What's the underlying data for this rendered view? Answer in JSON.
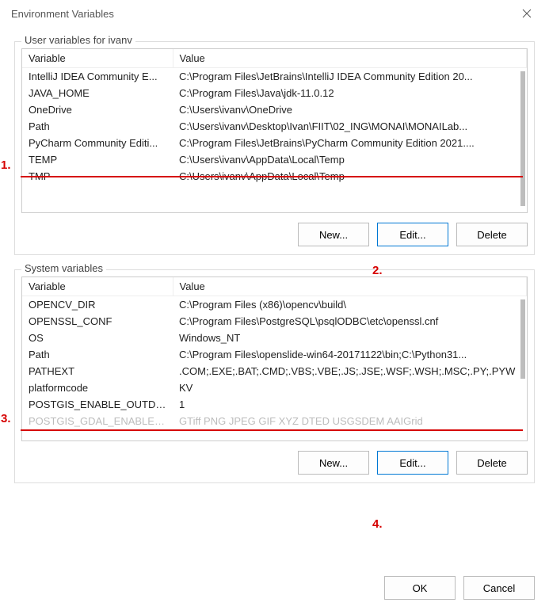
{
  "window": {
    "title": "Environment Variables"
  },
  "user_group": {
    "legend": "User variables for ivanv",
    "columns": {
      "var": "Variable",
      "val": "Value"
    },
    "rows": [
      {
        "var": "IntelliJ IDEA Community E...",
        "val": "C:\\Program Files\\JetBrains\\IntelliJ IDEA Community Edition 20..."
      },
      {
        "var": "JAVA_HOME",
        "val": "C:\\Program Files\\Java\\jdk-11.0.12"
      },
      {
        "var": "OneDrive",
        "val": "C:\\Users\\ivanv\\OneDrive"
      },
      {
        "var": "Path",
        "val": "C:\\Users\\ivanv\\Desktop\\Ivan\\FIIT\\02_ING\\MONAI\\MONAILab..."
      },
      {
        "var": "PyCharm Community Editi...",
        "val": "C:\\Program Files\\JetBrains\\PyCharm Community Edition 2021...."
      },
      {
        "var": "TEMP",
        "val": "C:\\Users\\ivanv\\AppData\\Local\\Temp"
      },
      {
        "var": "TMP",
        "val": "C:\\Users\\ivanv\\AppData\\Local\\Temp"
      }
    ],
    "buttons": {
      "new": "New...",
      "edit": "Edit...",
      "delete": "Delete"
    }
  },
  "sys_group": {
    "legend": "System variables",
    "columns": {
      "var": "Variable",
      "val": "Value"
    },
    "rows": [
      {
        "var": "OPENCV_DIR",
        "val": "C:\\Program Files (x86)\\opencv\\build\\"
      },
      {
        "var": "OPENSSL_CONF",
        "val": "C:\\Program Files\\PostgreSQL\\psqlODBC\\etc\\openssl.cnf"
      },
      {
        "var": "OS",
        "val": "Windows_NT"
      },
      {
        "var": "Path",
        "val": "C:\\Program Files\\openslide-win64-20171122\\bin;C:\\Python31..."
      },
      {
        "var": "PATHEXT",
        "val": ".COM;.EXE;.BAT;.CMD;.VBS;.VBE;.JS;.JSE;.WSF;.WSH;.MSC;.PY;.PYW"
      },
      {
        "var": "platformcode",
        "val": "KV"
      },
      {
        "var": "POSTGIS_ENABLE_OUTDB_...",
        "val": "1"
      },
      {
        "var": "POSTGIS_GDAL_ENABLED...",
        "val": "GTiff PNG JPEG GIF XYZ DTED USGSDEM AAIGrid"
      }
    ],
    "buttons": {
      "new": "New...",
      "edit": "Edit...",
      "delete": "Delete"
    }
  },
  "dialog": {
    "ok": "OK",
    "cancel": "Cancel"
  },
  "annotations": {
    "a1": "1.",
    "a2": "2.",
    "a3": "3.",
    "a4": "4."
  }
}
